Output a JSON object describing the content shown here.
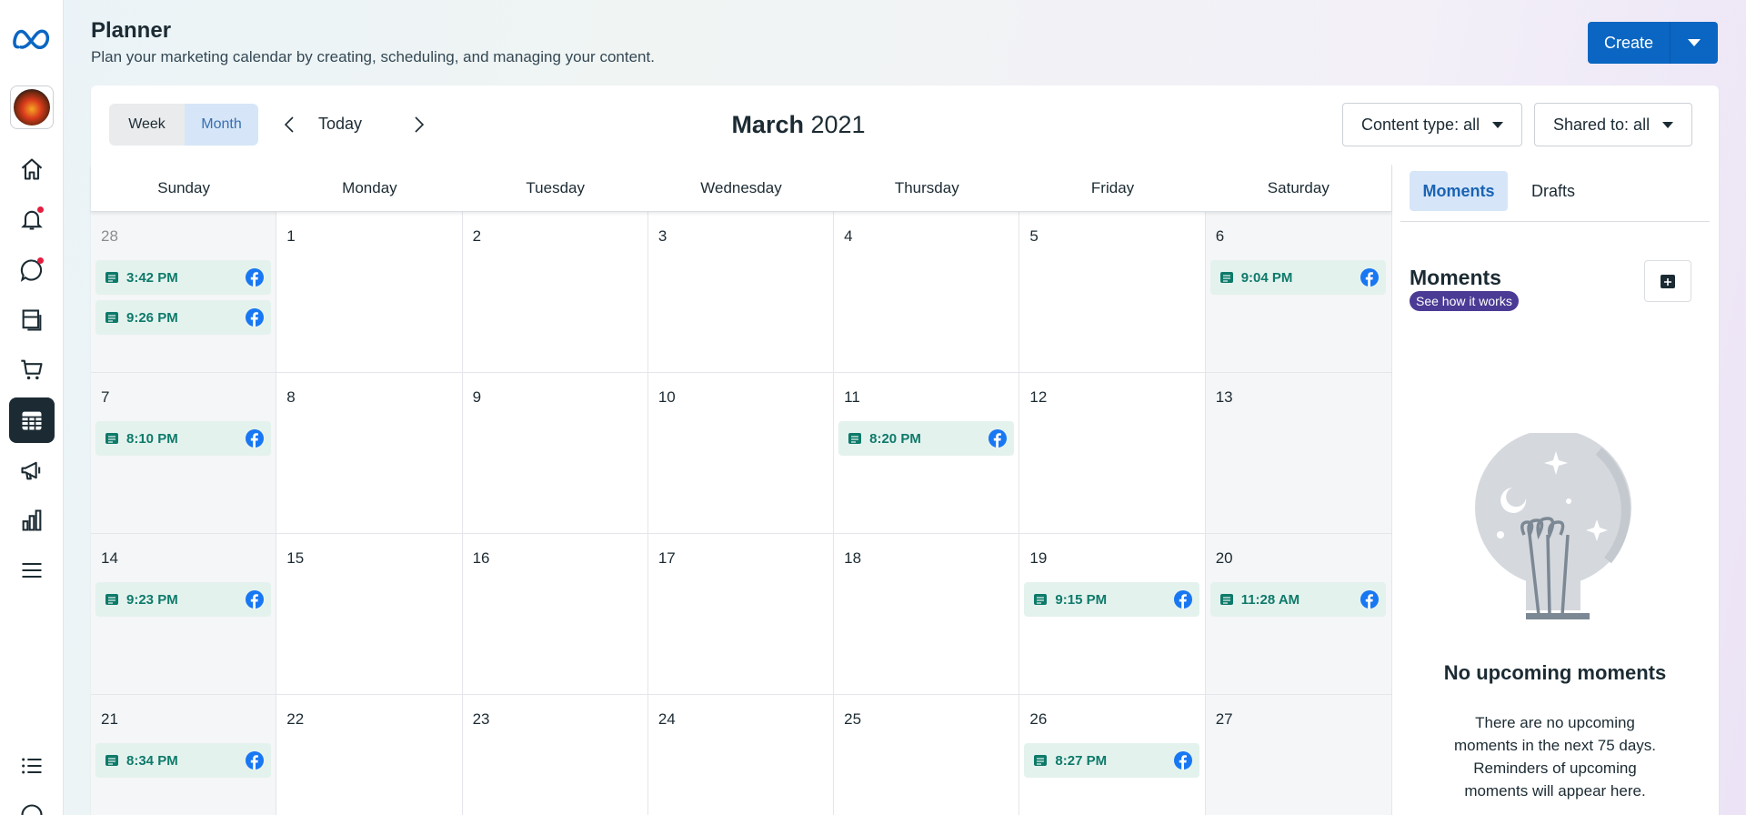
{
  "header": {
    "title": "Planner",
    "subtitle": "Plan your marketing calendar by creating, scheduling, and managing your content.",
    "create_label": "Create"
  },
  "sidebar": {
    "items": [
      {
        "name": "home"
      },
      {
        "name": "notifications",
        "badge": true
      },
      {
        "name": "inbox",
        "badge": true
      },
      {
        "name": "content"
      },
      {
        "name": "commerce"
      },
      {
        "name": "planner",
        "active": true
      },
      {
        "name": "ads"
      },
      {
        "name": "insights"
      },
      {
        "name": "all-tools"
      },
      {
        "name": "list"
      },
      {
        "name": "help"
      }
    ]
  },
  "toolbar": {
    "week_label": "Week",
    "month_label": "Month",
    "today_label": "Today",
    "month_name": "March",
    "year": "2021",
    "content_filter": "Content type: all",
    "shared_filter": "Shared to: all"
  },
  "calendar": {
    "weekdays": [
      "Sunday",
      "Monday",
      "Tuesday",
      "Wednesday",
      "Thursday",
      "Friday",
      "Saturday"
    ],
    "weeks": [
      [
        {
          "day": "28",
          "muted": true,
          "posts": [
            "3:42 PM",
            "9:26 PM"
          ]
        },
        {
          "day": "1",
          "posts": []
        },
        {
          "day": "2",
          "posts": []
        },
        {
          "day": "3",
          "posts": []
        },
        {
          "day": "4",
          "posts": []
        },
        {
          "day": "5",
          "posts": []
        },
        {
          "day": "6",
          "posts": [
            "9:04 PM"
          ]
        }
      ],
      [
        {
          "day": "7",
          "posts": [
            "8:10 PM"
          ]
        },
        {
          "day": "8",
          "posts": []
        },
        {
          "day": "9",
          "posts": []
        },
        {
          "day": "10",
          "posts": []
        },
        {
          "day": "11",
          "posts": [
            "8:20 PM"
          ]
        },
        {
          "day": "12",
          "posts": []
        },
        {
          "day": "13",
          "posts": []
        }
      ],
      [
        {
          "day": "14",
          "posts": [
            "9:23 PM"
          ]
        },
        {
          "day": "15",
          "posts": []
        },
        {
          "day": "16",
          "posts": []
        },
        {
          "day": "17",
          "posts": []
        },
        {
          "day": "18",
          "posts": []
        },
        {
          "day": "19",
          "posts": [
            "9:15 PM"
          ]
        },
        {
          "day": "20",
          "posts": [
            "11:28 AM"
          ]
        }
      ],
      [
        {
          "day": "21",
          "posts": [
            "8:34 PM"
          ]
        },
        {
          "day": "22",
          "posts": []
        },
        {
          "day": "23",
          "posts": []
        },
        {
          "day": "24",
          "posts": []
        },
        {
          "day": "25",
          "posts": []
        },
        {
          "day": "26",
          "posts": [
            "8:27 PM"
          ]
        },
        {
          "day": "27",
          "posts": []
        }
      ]
    ]
  },
  "panel": {
    "tab_moments": "Moments",
    "tab_drafts": "Drafts",
    "moments_title": "Moments",
    "how_it_works": "See how it works",
    "empty_title": "No upcoming moments",
    "empty_text": "There are no upcoming moments in the next 75 days. Reminders of upcoming moments will appear here."
  },
  "colors": {
    "accent": "#0a66c2",
    "post_bg": "#e4f2ee",
    "post_text": "#0e7a6a",
    "facebook": "#1877f2"
  }
}
